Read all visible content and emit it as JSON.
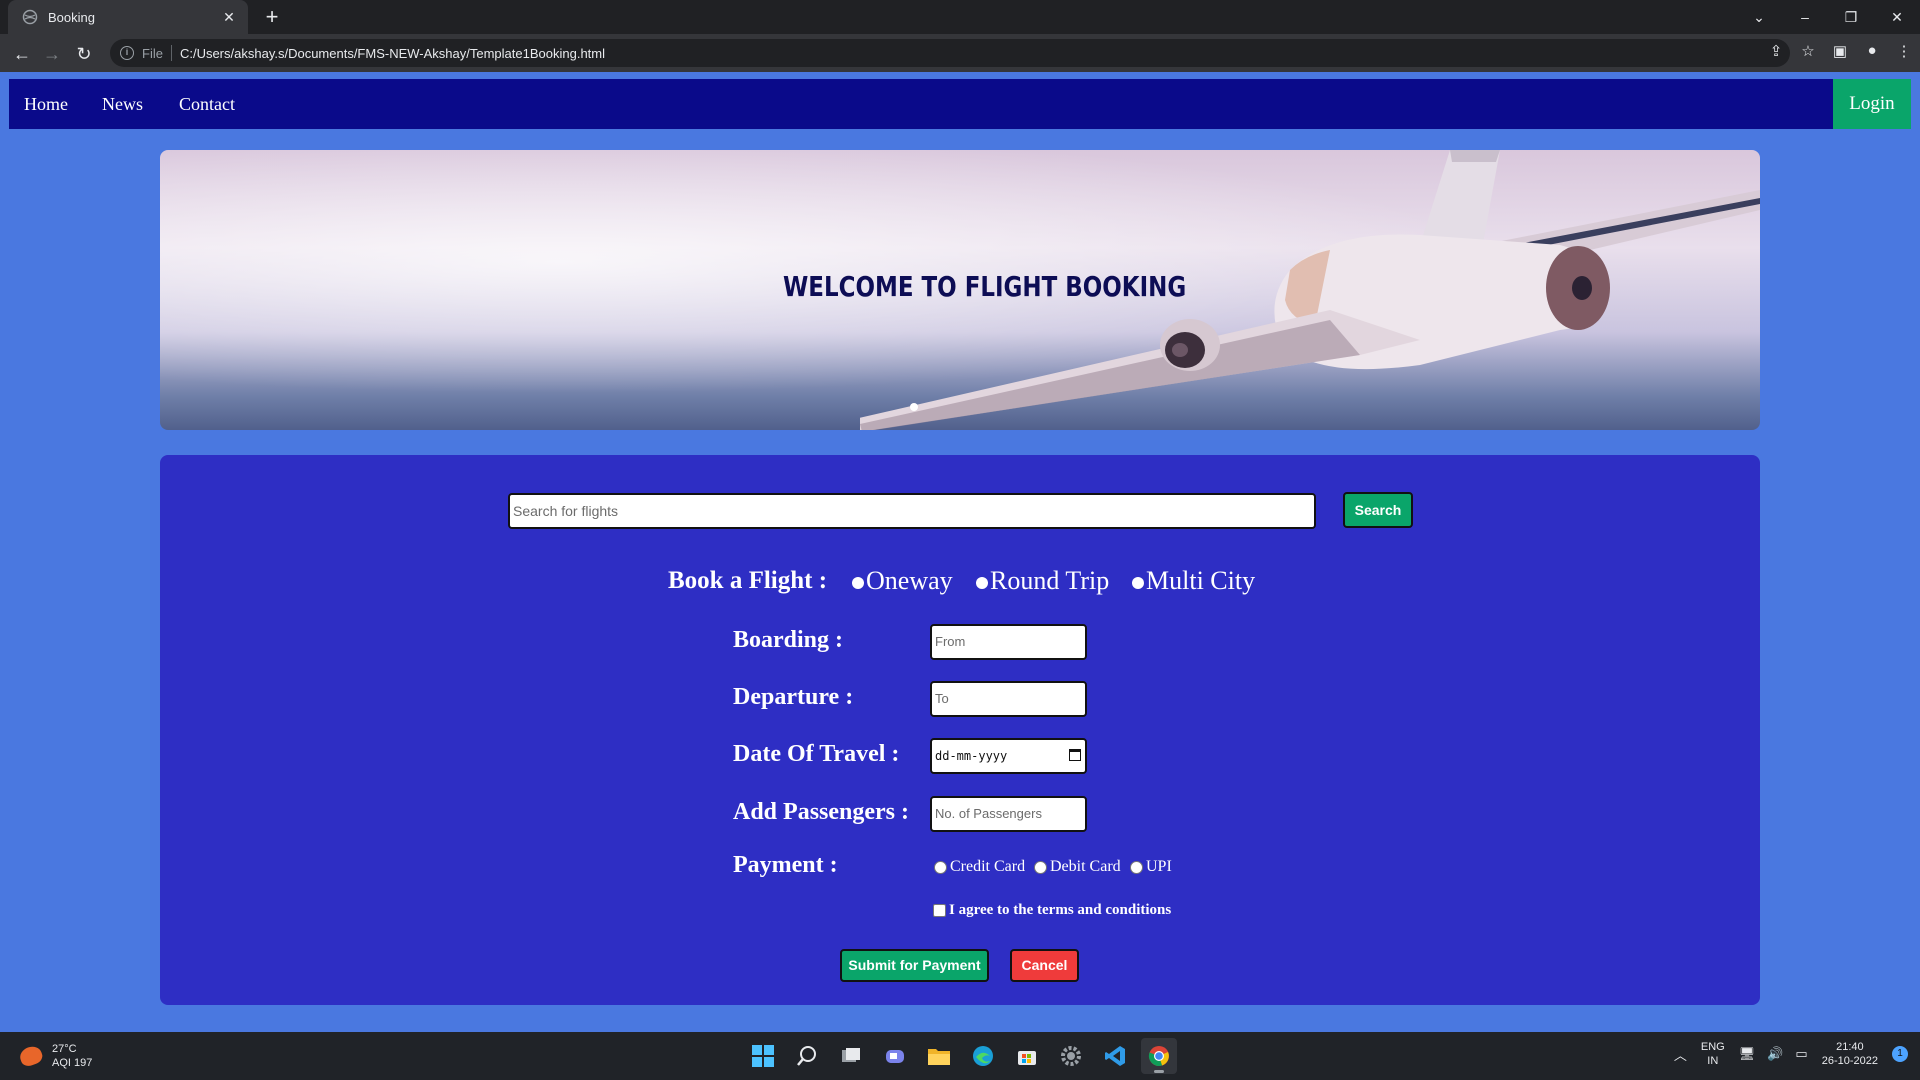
{
  "browser": {
    "tab_title": "Booking",
    "tab_close": "✕",
    "new_tab": "+",
    "file_label": "File",
    "url": "C:/Users/akshay.s/Documents/FMS-NEW-Akshay/Template1Booking.html",
    "window_controls": [
      "⌄",
      "–",
      "❐",
      "✕"
    ]
  },
  "navbar": {
    "links": [
      "Home",
      "News",
      "Contact"
    ],
    "login_label": "Login"
  },
  "banner": {
    "title": "WELCOME TO FLIGHT BOOKING"
  },
  "search": {
    "placeholder": "Search for flights",
    "button_label": "Search"
  },
  "booking": {
    "book_label": "Book a Flight :",
    "trip_options": [
      "Oneway",
      "Round Trip",
      "Multi City"
    ],
    "boarding_label": "Boarding :",
    "boarding_placeholder": "From",
    "departure_label": "Departure :",
    "departure_placeholder": "To",
    "date_label": "Date Of Travel :",
    "date_placeholder": "dd-mm-yyyy",
    "passengers_label": "Add Passengers :",
    "passengers_placeholder": "No. of Passengers",
    "payment_label": "Payment :",
    "payment_options": [
      "Credit Card",
      "Debit Card",
      "UPI"
    ],
    "terms_label": "I agree to the terms and conditions",
    "submit_label": "Submit for Payment",
    "cancel_label": "Cancel"
  },
  "taskbar": {
    "temperature": "27°C",
    "aqi": "AQI 197",
    "lang_line1": "ENG",
    "lang_line2": "IN",
    "time": "21:40",
    "date": "26-10-2022",
    "notification_count": "1"
  },
  "colors": {
    "page_bg": "#4a78e0",
    "navbar_bg": "#0a0a8a",
    "panel_bg": "#2e2ec4",
    "accent_green": "#0aa56a",
    "cancel_red": "#ef3b3b"
  }
}
